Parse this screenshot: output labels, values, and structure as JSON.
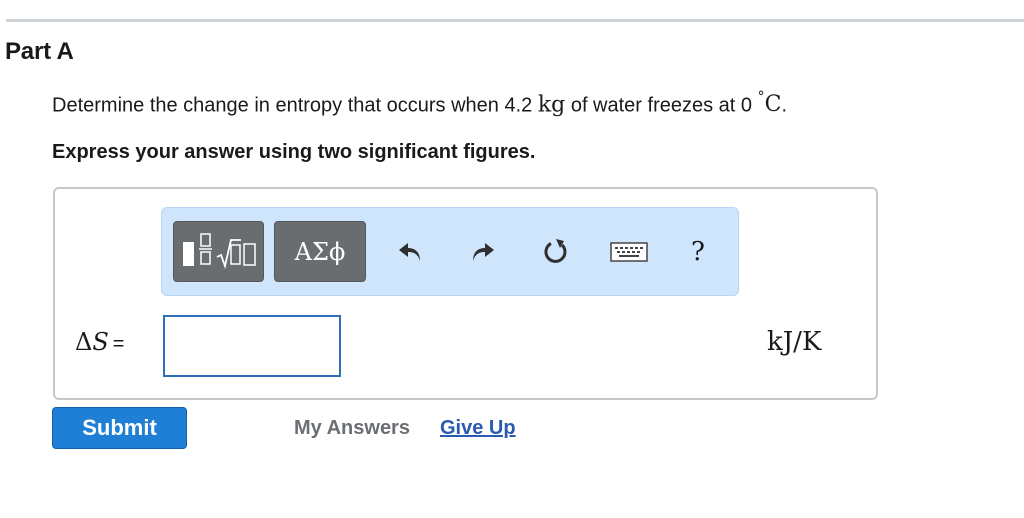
{
  "part": {
    "title": "Part A"
  },
  "question": {
    "prefix": "Determine the change in entropy that occurs when 4.2 ",
    "mass_unit": "kg",
    "middle": " of water freezes at 0 ",
    "degree": "°",
    "temp_unit": "C",
    "suffix": "."
  },
  "instruction": "Express your answer using two significant figures.",
  "toolbar": {
    "templates_icon": "templates-icon",
    "symbols_label": "ΑΣϕ",
    "undo_icon": "undo-icon",
    "redo_icon": "redo-icon",
    "reset_icon": "reset-icon",
    "keyboard_icon": "keyboard-icon",
    "help_label": "?"
  },
  "answer": {
    "symbol": "Δ",
    "variable": "S",
    "equals": "=",
    "value": "",
    "units": "kJ/K"
  },
  "actions": {
    "submit_label": "Submit",
    "my_answers_label": "My Answers",
    "give_up_label": "Give Up"
  },
  "colors": {
    "toolbar_bg": "#cfe5fb",
    "toolbar_button": "#6a6d70",
    "submit_bg": "#1f7fd6",
    "input_border": "#2f6fb7",
    "link": "#2a5bb0",
    "muted_link": "#6b6f73"
  }
}
